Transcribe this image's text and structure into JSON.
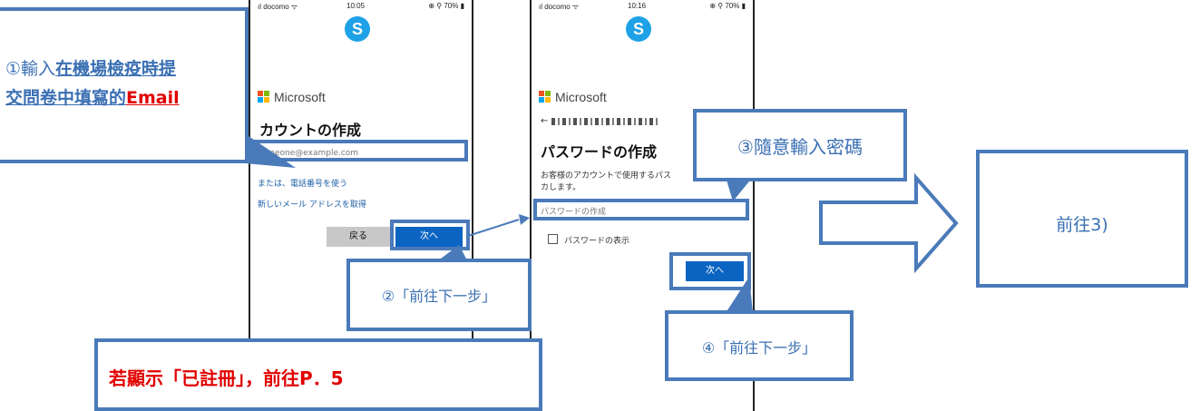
{
  "phone1": {
    "status": {
      "carrier": "ıl docomo ᯤ",
      "time": "10:05",
      "battery": "⊕ ⚲ 70% ▮"
    },
    "skype_letter": "S",
    "ms_name": "Microsoft",
    "heading": "カウントの作成",
    "email_placeholder": "someone@example.com",
    "phone_link": "または、電話番号を使う",
    "new_mail_link": "新しいメール アドレスを取得",
    "back_label": "戻る",
    "next_label": "次へ"
  },
  "phone2": {
    "status": {
      "carrier": "ıl docomo ᯤ",
      "time": "10:16",
      "battery": "⊕ ⚲ 70% ▮"
    },
    "skype_letter": "S",
    "ms_name": "Microsoft",
    "back_arrow": "←",
    "heading": "パスワードの作成",
    "desc_line1": "お客様のアカウントで使用するパス",
    "desc_line2": "カします。",
    "password_placeholder": "パスワードの作成",
    "show_password_label": "パスワードの表示",
    "next_label": "次へ"
  },
  "callouts": {
    "step1_prefix": "①輸入",
    "step1_underlined_1": "在機場檢疫時提",
    "step1_underlined_2": "交問卷中填寫的",
    "step1_email": "Email",
    "step2": "②「前往下一步」",
    "step3": "③隨意輸入密碼",
    "step4": "④「前往下一步」",
    "registered_note": "若顯示「已註冊」，前往P．5",
    "next_page": "前往3)"
  },
  "colors": {
    "callout_blue": "#4a7ab9",
    "text_blue": "#3a6fb3",
    "highlight_red": "#e10000",
    "button_blue": "#0b64c2",
    "skype_blue": "#1ea1e6"
  },
  "icons": {
    "skype": "skype-logo-icon",
    "microsoft": "microsoft-logo-icon",
    "arrow": "right-arrow-icon",
    "back": "back-arrow-icon"
  }
}
